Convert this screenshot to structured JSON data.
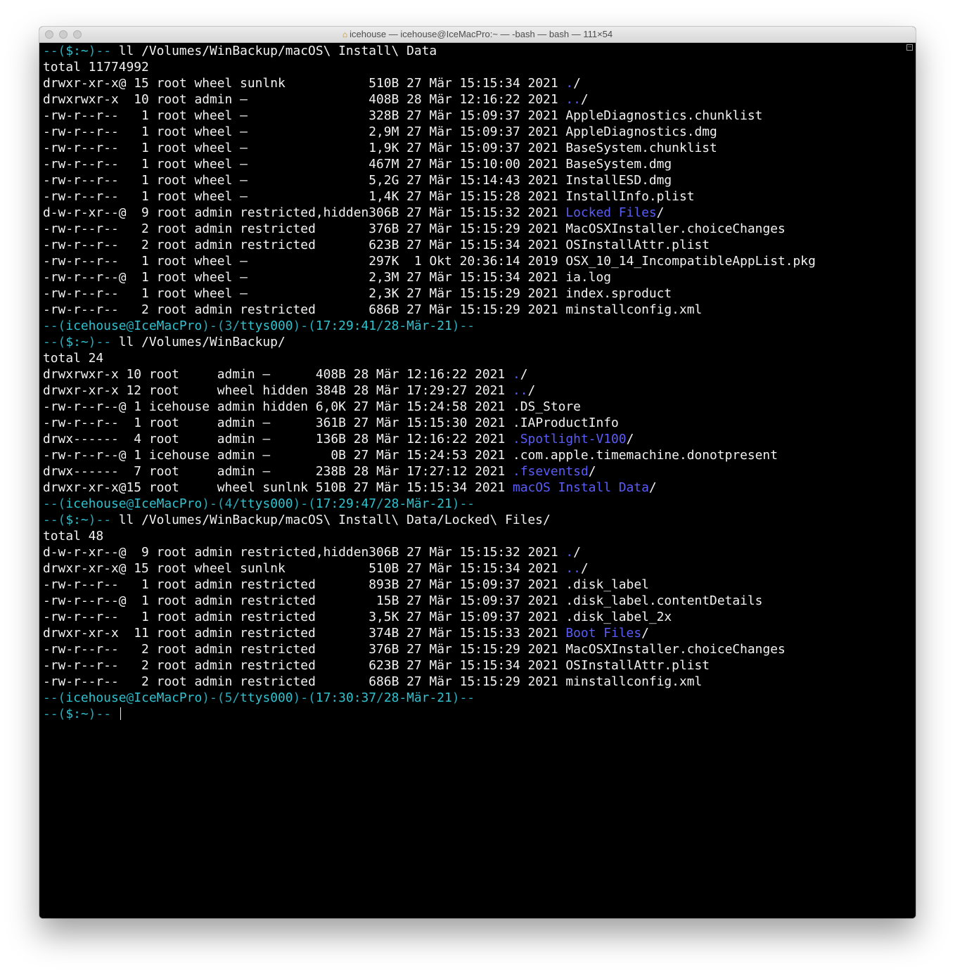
{
  "window": {
    "title": "icehouse — icehouse@IceMacPro:~ — -bash — bash — 111×54",
    "home_icon": "house-icon"
  },
  "colors": {
    "background": "#000000",
    "text": "#f2f2f2",
    "directory": "#5a5cf7",
    "prompt": "#2aa6b4"
  },
  "blocks": [
    {
      "prompt": "--($:~)--",
      "command": "ll /Volumes/WinBackup/macOS\\ Install\\ Data",
      "total": "total 11774992",
      "cols": [
        12,
        3,
        5,
        6,
        17,
        5,
        3,
        4,
        9,
        5
      ],
      "entries": [
        {
          "perm": "drwxr-xr-x@",
          "links": "15",
          "owner": "root",
          "group": "wheel",
          "flags": "sunlnk",
          "size": "510B",
          "day": "27",
          "mon": "Mär",
          "time": "15:15:34",
          "year": "2021",
          "name": "./",
          "dir": true
        },
        {
          "perm": "drwxrwxr-x",
          "links": "10",
          "owner": "root",
          "group": "admin",
          "flags": "–",
          "size": "408B",
          "day": "28",
          "mon": "Mär",
          "time": "12:16:22",
          "year": "2021",
          "name": "../",
          "dir": true
        },
        {
          "perm": "-rw-r--r--",
          "links": "1",
          "owner": "root",
          "group": "wheel",
          "flags": "–",
          "size": "328B",
          "day": "27",
          "mon": "Mär",
          "time": "15:09:37",
          "year": "2021",
          "name": "AppleDiagnostics.chunklist",
          "dir": false
        },
        {
          "perm": "-rw-r--r--",
          "links": "1",
          "owner": "root",
          "group": "wheel",
          "flags": "–",
          "size": "2,9M",
          "day": "27",
          "mon": "Mär",
          "time": "15:09:37",
          "year": "2021",
          "name": "AppleDiagnostics.dmg",
          "dir": false
        },
        {
          "perm": "-rw-r--r--",
          "links": "1",
          "owner": "root",
          "group": "wheel",
          "flags": "–",
          "size": "1,9K",
          "day": "27",
          "mon": "Mär",
          "time": "15:09:37",
          "year": "2021",
          "name": "BaseSystem.chunklist",
          "dir": false
        },
        {
          "perm": "-rw-r--r--",
          "links": "1",
          "owner": "root",
          "group": "wheel",
          "flags": "–",
          "size": "467M",
          "day": "27",
          "mon": "Mär",
          "time": "15:10:00",
          "year": "2021",
          "name": "BaseSystem.dmg",
          "dir": false
        },
        {
          "perm": "-rw-r--r--",
          "links": "1",
          "owner": "root",
          "group": "wheel",
          "flags": "–",
          "size": "5,2G",
          "day": "27",
          "mon": "Mär",
          "time": "15:14:43",
          "year": "2021",
          "name": "InstallESD.dmg",
          "dir": false
        },
        {
          "perm": "-rw-r--r--",
          "links": "1",
          "owner": "root",
          "group": "wheel",
          "flags": "–",
          "size": "1,4K",
          "day": "27",
          "mon": "Mär",
          "time": "15:15:28",
          "year": "2021",
          "name": "InstallInfo.plist",
          "dir": false
        },
        {
          "perm": "d-w-r-xr--@",
          "links": "9",
          "owner": "root",
          "group": "admin",
          "flags": "restricted,hidden",
          "size": "306B",
          "day": "27",
          "mon": "Mär",
          "time": "15:15:32",
          "year": "2021",
          "name": "Locked Files/",
          "dir": true
        },
        {
          "perm": "-rw-r--r--",
          "links": "2",
          "owner": "root",
          "group": "admin",
          "flags": "restricted",
          "size": "376B",
          "day": "27",
          "mon": "Mär",
          "time": "15:15:29",
          "year": "2021",
          "name": "MacOSXInstaller.choiceChanges",
          "dir": false
        },
        {
          "perm": "-rw-r--r--",
          "links": "2",
          "owner": "root",
          "group": "admin",
          "flags": "restricted",
          "size": "623B",
          "day": "27",
          "mon": "Mär",
          "time": "15:15:34",
          "year": "2021",
          "name": "OSInstallAttr.plist",
          "dir": false
        },
        {
          "perm": "-rw-r--r--",
          "links": "1",
          "owner": "root",
          "group": "wheel",
          "flags": "–",
          "size": "297K",
          "day": "1",
          "mon": "Okt",
          "time": "20:36:14",
          "year": "2019",
          "name": "OSX_10_14_IncompatibleAppList.pkg",
          "dir": false
        },
        {
          "perm": "-rw-r--r--@",
          "links": "1",
          "owner": "root",
          "group": "wheel",
          "flags": "–",
          "size": "2,3M",
          "day": "27",
          "mon": "Mär",
          "time": "15:15:34",
          "year": "2021",
          "name": "ia.log",
          "dir": false
        },
        {
          "perm": "-rw-r--r--",
          "links": "1",
          "owner": "root",
          "group": "wheel",
          "flags": "–",
          "size": "2,3K",
          "day": "27",
          "mon": "Mär",
          "time": "15:15:29",
          "year": "2021",
          "name": "index.sproduct",
          "dir": false
        },
        {
          "perm": "-rw-r--r--",
          "links": "2",
          "owner": "root",
          "group": "admin",
          "flags": "restricted",
          "size": "686B",
          "day": "27",
          "mon": "Mär",
          "time": "15:15:29",
          "year": "2021",
          "name": "minstallconfig.xml",
          "dir": false
        }
      ],
      "status": {
        "user": "icehouse",
        "host": "IceMacPro",
        "num": "3",
        "tty": "ttys000",
        "time": "17:29:41",
        "date": "28-Mär-21"
      }
    },
    {
      "prompt": "--($:~)--",
      "command": "ll /Volumes/WinBackup/",
      "total": "total 24",
      "cols": [
        11,
        3,
        9,
        6,
        7,
        5,
        3,
        4,
        9,
        5
      ],
      "entries": [
        {
          "perm": "drwxrwxr-x",
          "links": "10",
          "owner": "root",
          "group": "admin",
          "flags": "–",
          "size": "408B",
          "day": "28",
          "mon": "Mär",
          "time": "12:16:22",
          "year": "2021",
          "name": "./",
          "dir": true
        },
        {
          "perm": "drwxr-xr-x",
          "links": "12",
          "owner": "root",
          "group": "wheel",
          "flags": "hidden",
          "size": "384B",
          "day": "28",
          "mon": "Mär",
          "time": "17:29:27",
          "year": "2021",
          "name": "../",
          "dir": true
        },
        {
          "perm": "-rw-r--r--@",
          "links": "1",
          "owner": "icehouse",
          "group": "admin",
          "flags": "hidden",
          "size": "6,0K",
          "day": "27",
          "mon": "Mär",
          "time": "15:24:58",
          "year": "2021",
          "name": ".DS_Store",
          "dir": false
        },
        {
          "perm": "-rw-r--r--",
          "links": "1",
          "owner": "root",
          "group": "admin",
          "flags": "–",
          "size": "361B",
          "day": "27",
          "mon": "Mär",
          "time": "15:15:30",
          "year": "2021",
          "name": ".IAProductInfo",
          "dir": false
        },
        {
          "perm": "drwx------",
          "links": "4",
          "owner": "root",
          "group": "admin",
          "flags": "–",
          "size": "136B",
          "day": "28",
          "mon": "Mär",
          "time": "12:16:22",
          "year": "2021",
          "name": ".Spotlight-V100/",
          "dir": true
        },
        {
          "perm": "-rw-r--r--@",
          "links": "1",
          "owner": "icehouse",
          "group": "admin",
          "flags": "–",
          "size": "0B",
          "day": "27",
          "mon": "Mär",
          "time": "15:24:53",
          "year": "2021",
          "name": ".com.apple.timemachine.donotpresent",
          "dir": false
        },
        {
          "perm": "drwx------",
          "links": "7",
          "owner": "root",
          "group": "admin",
          "flags": "–",
          "size": "238B",
          "day": "28",
          "mon": "Mär",
          "time": "17:27:12",
          "year": "2021",
          "name": ".fseventsd/",
          "dir": true
        },
        {
          "perm": "drwxr-xr-x@",
          "links": "15",
          "owner": "root",
          "group": "wheel",
          "flags": "sunlnk",
          "size": "510B",
          "day": "27",
          "mon": "Mär",
          "time": "15:15:34",
          "year": "2021",
          "name": "macOS Install Data/",
          "dir": true
        }
      ],
      "status": {
        "user": "icehouse",
        "host": "IceMacPro",
        "num": "4",
        "tty": "ttys000",
        "time": "17:29:47",
        "date": "28-Mär-21"
      }
    },
    {
      "prompt": "--($:~)--",
      "command": "ll /Volumes/WinBackup/macOS\\ Install\\ Data/Locked\\ Files/",
      "total": "total 48",
      "cols": [
        12,
        3,
        5,
        6,
        17,
        5,
        3,
        4,
        9,
        5
      ],
      "entries": [
        {
          "perm": "d-w-r-xr--@",
          "links": "9",
          "owner": "root",
          "group": "admin",
          "flags": "restricted,hidden",
          "size": "306B",
          "day": "27",
          "mon": "Mär",
          "time": "15:15:32",
          "year": "2021",
          "name": "./",
          "dir": true
        },
        {
          "perm": "drwxr-xr-x@",
          "links": "15",
          "owner": "root",
          "group": "wheel",
          "flags": "sunlnk",
          "size": "510B",
          "day": "27",
          "mon": "Mär",
          "time": "15:15:34",
          "year": "2021",
          "name": "../",
          "dir": true
        },
        {
          "perm": "-rw-r--r--",
          "links": "1",
          "owner": "root",
          "group": "admin",
          "flags": "restricted",
          "size": "893B",
          "day": "27",
          "mon": "Mär",
          "time": "15:09:37",
          "year": "2021",
          "name": ".disk_label",
          "dir": false
        },
        {
          "perm": "-rw-r--r--@",
          "links": "1",
          "owner": "root",
          "group": "admin",
          "flags": "restricted",
          "size": "15B",
          "day": "27",
          "mon": "Mär",
          "time": "15:09:37",
          "year": "2021",
          "name": ".disk_label.contentDetails",
          "dir": false
        },
        {
          "perm": "-rw-r--r--",
          "links": "1",
          "owner": "root",
          "group": "admin",
          "flags": "restricted",
          "size": "3,5K",
          "day": "27",
          "mon": "Mär",
          "time": "15:09:37",
          "year": "2021",
          "name": ".disk_label_2x",
          "dir": false
        },
        {
          "perm": "drwxr-xr-x",
          "links": "11",
          "owner": "root",
          "group": "admin",
          "flags": "restricted",
          "size": "374B",
          "day": "27",
          "mon": "Mär",
          "time": "15:15:33",
          "year": "2021",
          "name": "Boot Files/",
          "dir": true
        },
        {
          "perm": "-rw-r--r--",
          "links": "2",
          "owner": "root",
          "group": "admin",
          "flags": "restricted",
          "size": "376B",
          "day": "27",
          "mon": "Mär",
          "time": "15:15:29",
          "year": "2021",
          "name": "MacOSXInstaller.choiceChanges",
          "dir": false
        },
        {
          "perm": "-rw-r--r--",
          "links": "2",
          "owner": "root",
          "group": "admin",
          "flags": "restricted",
          "size": "623B",
          "day": "27",
          "mon": "Mär",
          "time": "15:15:34",
          "year": "2021",
          "name": "OSInstallAttr.plist",
          "dir": false
        },
        {
          "perm": "-rw-r--r--",
          "links": "2",
          "owner": "root",
          "group": "admin",
          "flags": "restricted",
          "size": "686B",
          "day": "27",
          "mon": "Mär",
          "time": "15:15:29",
          "year": "2021",
          "name": "minstallconfig.xml",
          "dir": false
        }
      ],
      "status": {
        "user": "icehouse",
        "host": "IceMacPro",
        "num": "5",
        "tty": "ttys000",
        "time": "17:30:37",
        "date": "28-Mär-21"
      }
    }
  ],
  "final_prompt": "--($:~)--"
}
